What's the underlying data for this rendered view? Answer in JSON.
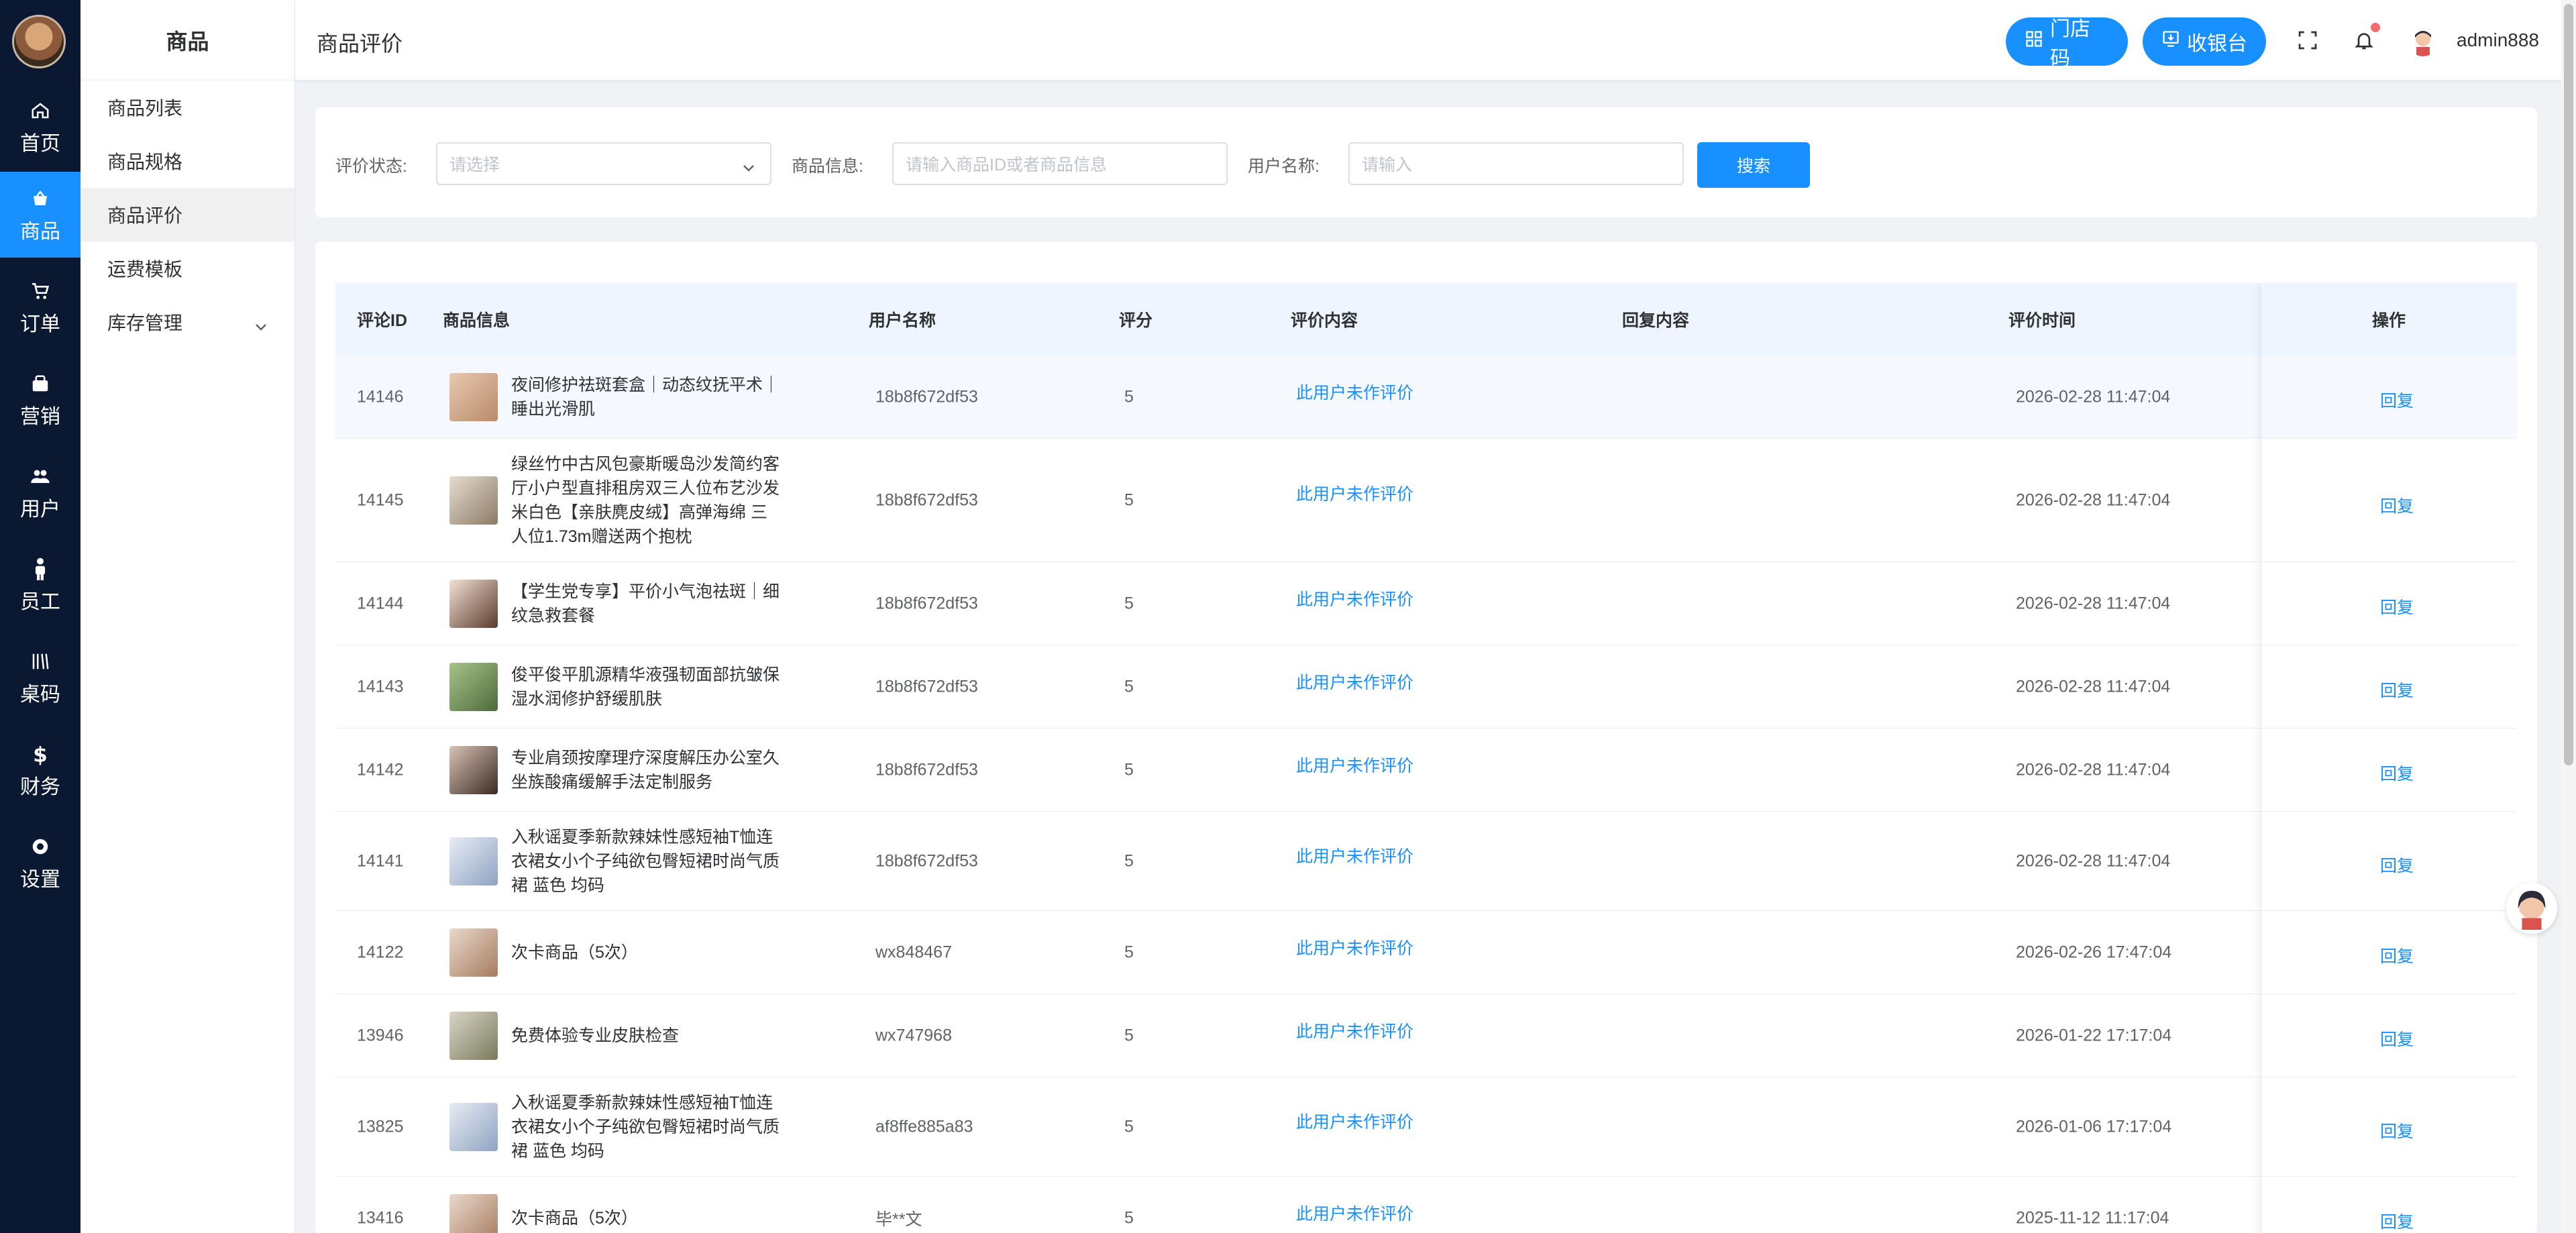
{
  "rail": {
    "items": [
      {
        "label": "首页",
        "icon": "home-icon"
      },
      {
        "label": "商品",
        "icon": "shop-icon"
      },
      {
        "label": "订单",
        "icon": "cart-icon"
      },
      {
        "label": "营销",
        "icon": "bag-icon"
      },
      {
        "label": "用户",
        "icon": "users-icon"
      },
      {
        "label": "员工",
        "icon": "person-icon"
      },
      {
        "label": "桌码",
        "icon": "qrcode-icon"
      },
      {
        "label": "财务",
        "icon": "dollar-icon"
      },
      {
        "label": "设置",
        "icon": "settings-icon"
      }
    ]
  },
  "submenu": {
    "title": "商品",
    "items": [
      {
        "label": "商品列表"
      },
      {
        "label": "商品规格"
      },
      {
        "label": "商品评价"
      },
      {
        "label": "运费模板"
      },
      {
        "label": "库存管理"
      }
    ]
  },
  "header": {
    "title": "商品评价",
    "store_code": "门店码",
    "cashier": "收银台",
    "username": "admin888"
  },
  "filter": {
    "status_label": "评价状态:",
    "status_placeholder": "请选择",
    "product_label": "商品信息:",
    "product_placeholder": "请输入商品ID或者商品信息",
    "user_label": "用户名称:",
    "user_placeholder": "请输入",
    "search_button": "搜索"
  },
  "table": {
    "columns": {
      "id": "评论ID",
      "product": "商品信息",
      "user": "用户名称",
      "score": "评分",
      "content": "评价内容",
      "reply": "回复内容",
      "time": "评价时间",
      "action": "操作"
    },
    "rows": [
      {
        "id": "14146",
        "product": "夜间修护祛斑套盒｜动态纹抚平术｜睡出光滑肌",
        "user": "18b8f672df53",
        "score": "5",
        "content": "此用户未作评价",
        "reply": "",
        "time": "2026-02-28 11:47:04",
        "action": "回复"
      },
      {
        "id": "14145",
        "product": "绿丝竹中古风包豪斯暖岛沙发简约客厅小户型直排租房双三人位布艺沙发 米白色【亲肤麂皮绒】高弹海绵 三人位1.73m赠送两个抱枕",
        "user": "18b8f672df53",
        "score": "5",
        "content": "此用户未作评价",
        "reply": "",
        "time": "2026-02-28 11:47:04",
        "action": "回复"
      },
      {
        "id": "14144",
        "product": "【学生党专享】平价小气泡祛斑｜细纹急救套餐",
        "user": "18b8f672df53",
        "score": "5",
        "content": "此用户未作评价",
        "reply": "",
        "time": "2026-02-28 11:47:04",
        "action": "回复"
      },
      {
        "id": "14143",
        "product": "俊平俊平肌源精华液强韧面部抗皱保湿水润修护舒缓肌肤",
        "user": "18b8f672df53",
        "score": "5",
        "content": "此用户未作评价",
        "reply": "",
        "time": "2026-02-28 11:47:04",
        "action": "回复"
      },
      {
        "id": "14142",
        "product": "专业肩颈按摩理疗深度解压办公室久坐族酸痛缓解手法定制服务",
        "user": "18b8f672df53",
        "score": "5",
        "content": "此用户未作评价",
        "reply": "",
        "time": "2026-02-28 11:47:04",
        "action": "回复"
      },
      {
        "id": "14141",
        "product": "入秋谣夏季新款辣妹性感短袖T恤连衣裙女小个子纯欲包臀短裙时尚气质裙 蓝色 均码",
        "user": "18b8f672df53",
        "score": "5",
        "content": "此用户未作评价",
        "reply": "",
        "time": "2026-02-28 11:47:04",
        "action": "回复"
      },
      {
        "id": "14122",
        "product": "次卡商品（5次）",
        "user": "wx848467",
        "score": "5",
        "content": "此用户未作评价",
        "reply": "",
        "time": "2026-02-26 17:47:04",
        "action": "回复"
      },
      {
        "id": "13946",
        "product": "免费体验专业皮肤检查",
        "user": "wx747968",
        "score": "5",
        "content": "此用户未作评价",
        "reply": "",
        "time": "2026-01-22 17:17:04",
        "action": "回复"
      },
      {
        "id": "13825",
        "product": "入秋谣夏季新款辣妹性感短袖T恤连衣裙女小个子纯欲包臀短裙时尚气质裙 蓝色 均码",
        "user": "af8ffe885a83",
        "score": "5",
        "content": "此用户未作评价",
        "reply": "",
        "time": "2026-01-06 17:17:04",
        "action": "回复"
      },
      {
        "id": "13416",
        "product": "次卡商品（5次）",
        "user": "毕**文",
        "score": "5",
        "content": "此用户未作评价",
        "reply": "",
        "time": "2025-11-12 11:17:04",
        "action": "回复"
      }
    ]
  },
  "colors": {
    "primary": "#1890ff",
    "rail_bg": "#0a1931",
    "header_row_bg": "#eef5ff"
  }
}
